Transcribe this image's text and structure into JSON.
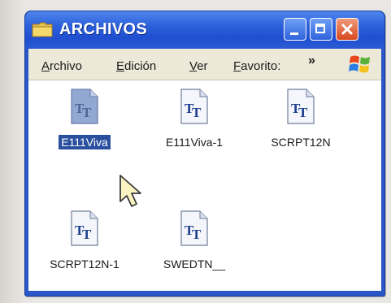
{
  "window": {
    "title": "ARCHIVOS",
    "title_icon": "folder-icon",
    "controls": [
      "minimize-icon",
      "maximize-icon",
      "close-icon"
    ]
  },
  "menubar": {
    "items": [
      {
        "label_first": "A",
        "label_rest": "rchivo"
      },
      {
        "label_first": "E",
        "label_rest": "dición"
      },
      {
        "label_first": "V",
        "label_rest": "er"
      },
      {
        "label_first": "F",
        "label_rest": "avorito:"
      }
    ],
    "overflow": "»",
    "logo": "windows-logo-icon"
  },
  "files": [
    {
      "name": "E111Viva",
      "icon": "truetype-font-file-icon",
      "selected": true
    },
    {
      "name": "E111Viva-1",
      "icon": "truetype-font-file-icon",
      "selected": false
    },
    {
      "name": "SCRPT12N",
      "icon": "truetype-font-file-icon",
      "selected": false
    },
    {
      "name": "SCRPT12N-1",
      "icon": "truetype-font-file-icon",
      "selected": false
    },
    {
      "name": "SWEDTN__",
      "icon": "truetype-font-file-icon",
      "selected": false
    }
  ],
  "cursor": "arrow-cursor-icon",
  "colors": {
    "titlebar": "#2f63dc",
    "selection": "#2a4f9e",
    "menubar": "#ece9d8",
    "close_button": "#d9481e"
  }
}
